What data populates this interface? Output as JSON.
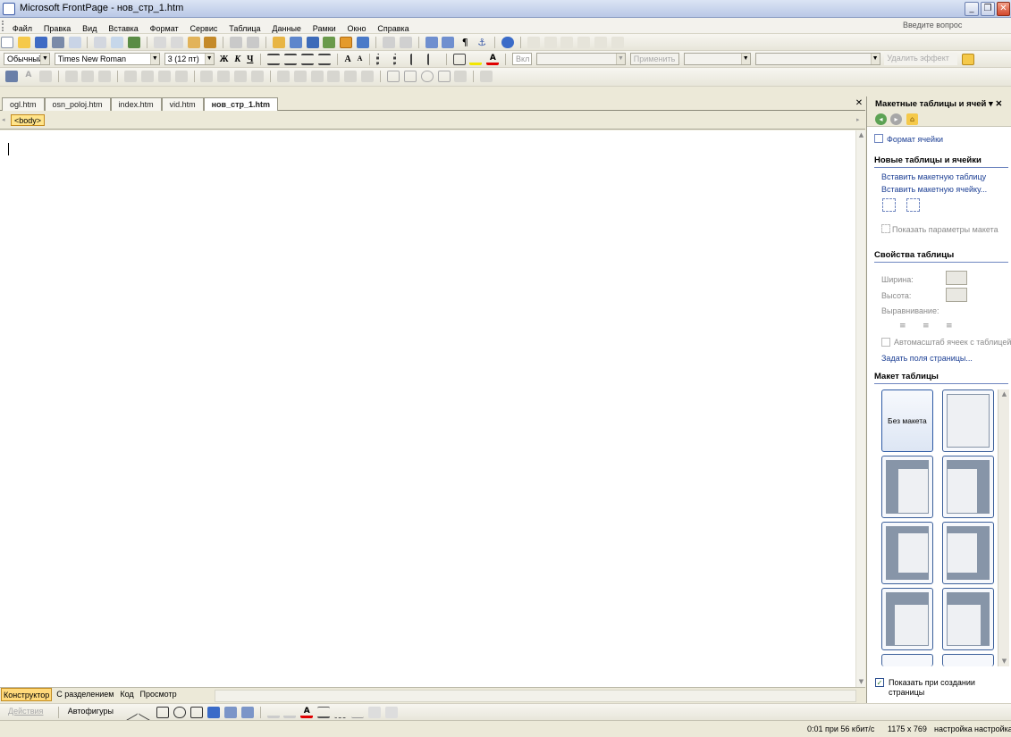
{
  "window": {
    "title": "Microsoft FrontPage - нов_стр_1.htm"
  },
  "menu": [
    "Файл",
    "Правка",
    "Вид",
    "Вставка",
    "Формат",
    "Сервис",
    "Таблица",
    "Данные",
    "Рамки",
    "Окно",
    "Справка"
  ],
  "help_box": "Введите вопрос",
  "format_toolbar": {
    "style": "Обычный",
    "font": "Times New Roman",
    "size": "3 (12 пт)",
    "effect_label": "Вкл",
    "apply_label": "Применить",
    "remove_effect": "Удалить эффект"
  },
  "tabs": [
    "ogl.htm",
    "osn_poloj.htm",
    "index.htm",
    "vid.htm",
    "нов_стр_1.htm"
  ],
  "active_tab_index": 4,
  "tag_selector": "<body>",
  "view_tabs": [
    "Конструктор",
    "С разделением",
    "Код",
    "Просмотр"
  ],
  "drawing_toolbar": {
    "actions": "Действия",
    "autoshapes": "Автофигуры"
  },
  "status": {
    "speed": "0:01 при 56 кбит/с",
    "resolution": "1175 x 769",
    "setting1": "настройка",
    "setting2": "настройка"
  },
  "task_pane": {
    "title": "Макетные таблицы и ячей",
    "cell_format_link": "Формат ячейки",
    "new_section": "Новые таблицы и ячейки",
    "insert_table": "Вставить макетную таблицу",
    "insert_cell": "Вставить макетную ячейку...",
    "show_params": "Показать параметры макета",
    "props_section": "Свойства таблицы",
    "width_label": "Ширина:",
    "height_label": "Высота:",
    "align_label": "Выравнивание:",
    "autoscale": "Автомасштаб ячеек с таблицей",
    "page_margins": "Задать поля страницы...",
    "layout_section": "Макет таблицы",
    "no_layout": "Без макета",
    "show_on_create_line1": "Показать при создании",
    "show_on_create_line2": "страницы"
  },
  "colors": {
    "accent": "#316ac5",
    "tag_bg": "#ffe48a",
    "active_view": "#ffd97a"
  }
}
